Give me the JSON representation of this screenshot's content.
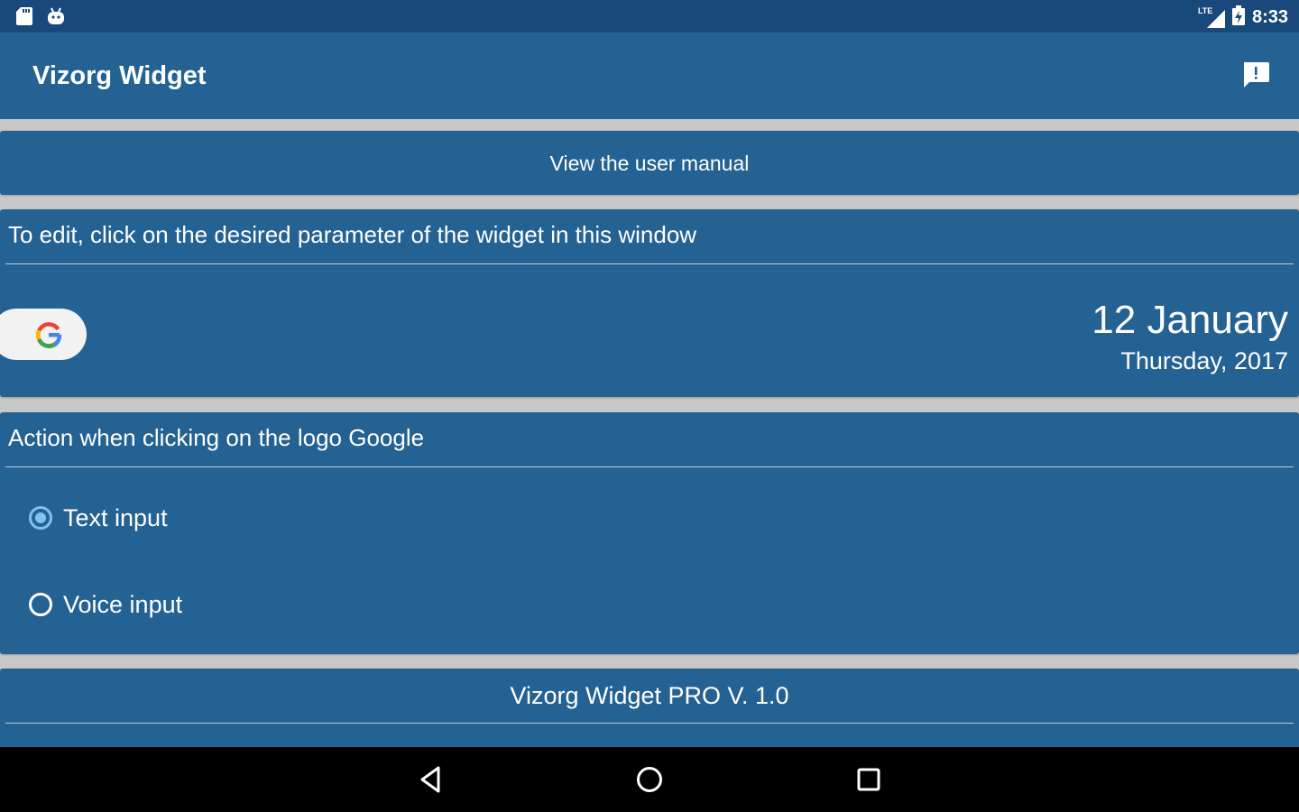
{
  "status_bar": {
    "left_icons": [
      "sd-card-icon",
      "android-icon"
    ],
    "network_label": "LTE",
    "time": "8:33"
  },
  "app_bar": {
    "title": "Vizorg Widget",
    "action_icon": "feedback-icon"
  },
  "manual_button": {
    "label": "View the user manual"
  },
  "widget_editor": {
    "heading": "To edit, click on the desired parameter of the widget in this window",
    "google_logo_icon": "google-g-icon",
    "date_main": "12 January",
    "date_sub": "Thursday, 2017"
  },
  "google_action": {
    "heading": "Action when clicking on the logo Google",
    "options": [
      {
        "label": "Text input",
        "checked": true
      },
      {
        "label": "Voice input",
        "checked": false
      }
    ]
  },
  "footer": {
    "version_text": "Vizorg Widget PRO  V. 1.0"
  },
  "nav_bar": {
    "icons": [
      "back-icon",
      "home-icon",
      "recents-icon"
    ]
  },
  "colors": {
    "primary": "#246293",
    "status_bar": "#18497a",
    "radio_accent": "#7fc1f2",
    "background": "#c8c8c8"
  }
}
